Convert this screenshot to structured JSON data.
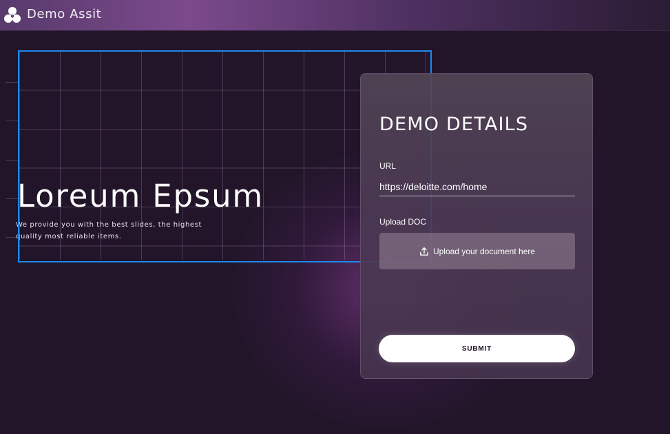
{
  "header": {
    "app_title": "Demo Assit",
    "logo_icon": "cluster-logo-icon"
  },
  "hero": {
    "title": "Loreum Epsum",
    "subtitle": "We provide you with the best slides, the highest quality most reliable items."
  },
  "form": {
    "title": "DEMO DETAILS",
    "url_label": "URL",
    "url_value": "https://deloitte.com/home",
    "upload_label": "Upload DOC",
    "upload_text": "Upload your document here",
    "upload_icon": "upload-icon",
    "submit_label": "SUBMIT"
  },
  "colors": {
    "background": "#221529",
    "header_accent": "#7b4a8c",
    "selection_outline": "#1e88f0",
    "submit_background": "#ffffff"
  }
}
